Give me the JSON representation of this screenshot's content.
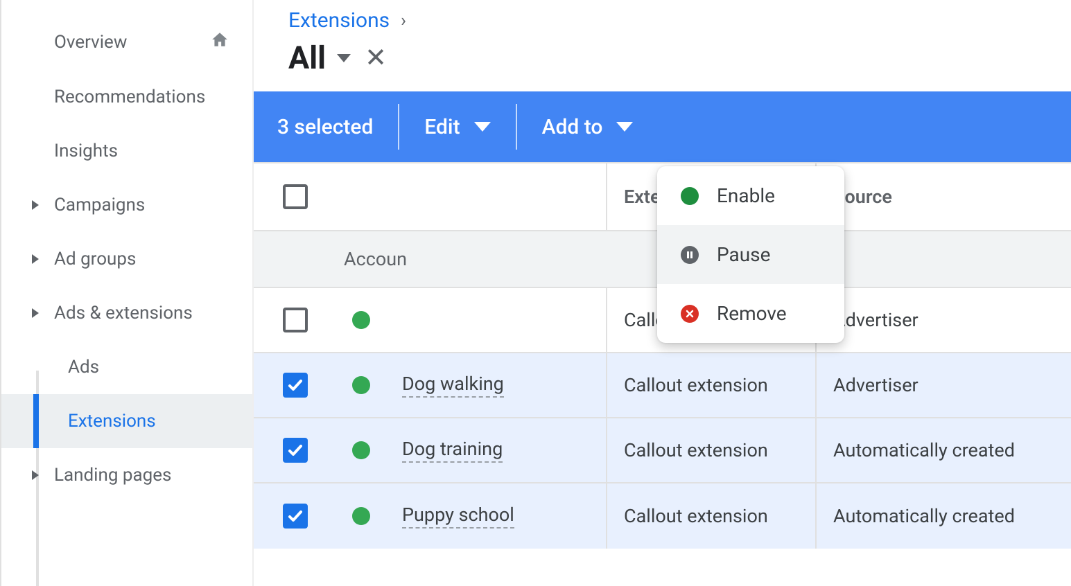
{
  "sidebar": {
    "items": [
      {
        "label": "Overview",
        "caret": false,
        "home": true
      },
      {
        "label": "Recommendations",
        "caret": false
      },
      {
        "label": "Insights",
        "caret": false
      },
      {
        "label": "Campaigns",
        "caret": true
      },
      {
        "label": "Ad groups",
        "caret": true
      },
      {
        "label": "Ads & extensions",
        "caret": true
      },
      {
        "label": "Ads",
        "caret": false,
        "sub": true
      },
      {
        "label": "Extensions",
        "caret": false,
        "sub": true,
        "active": true
      },
      {
        "label": "Landing pages",
        "caret": true
      }
    ]
  },
  "breadcrumb": {
    "label": "Extensions"
  },
  "filter": {
    "label": "All"
  },
  "action_bar": {
    "selected_text": "3 selected",
    "edit_label": "Edit",
    "addto_label": "Add to"
  },
  "edit_menu": {
    "enable": "Enable",
    "pause": "Pause",
    "remove": "Remove"
  },
  "table": {
    "headers": {
      "type": "Extension type",
      "source": "Source"
    },
    "group_label": "Accoun",
    "rows": [
      {
        "checked": false,
        "name": "",
        "type": "Callout extension",
        "source": "Advertiser"
      },
      {
        "checked": true,
        "name": "Dog walking",
        "type": "Callout extension",
        "source": "Advertiser"
      },
      {
        "checked": true,
        "name": "Dog training",
        "type": "Callout extension",
        "source": "Automatically created"
      },
      {
        "checked": true,
        "name": "Puppy school",
        "type": "Callout extension",
        "source": "Automatically created"
      }
    ]
  }
}
